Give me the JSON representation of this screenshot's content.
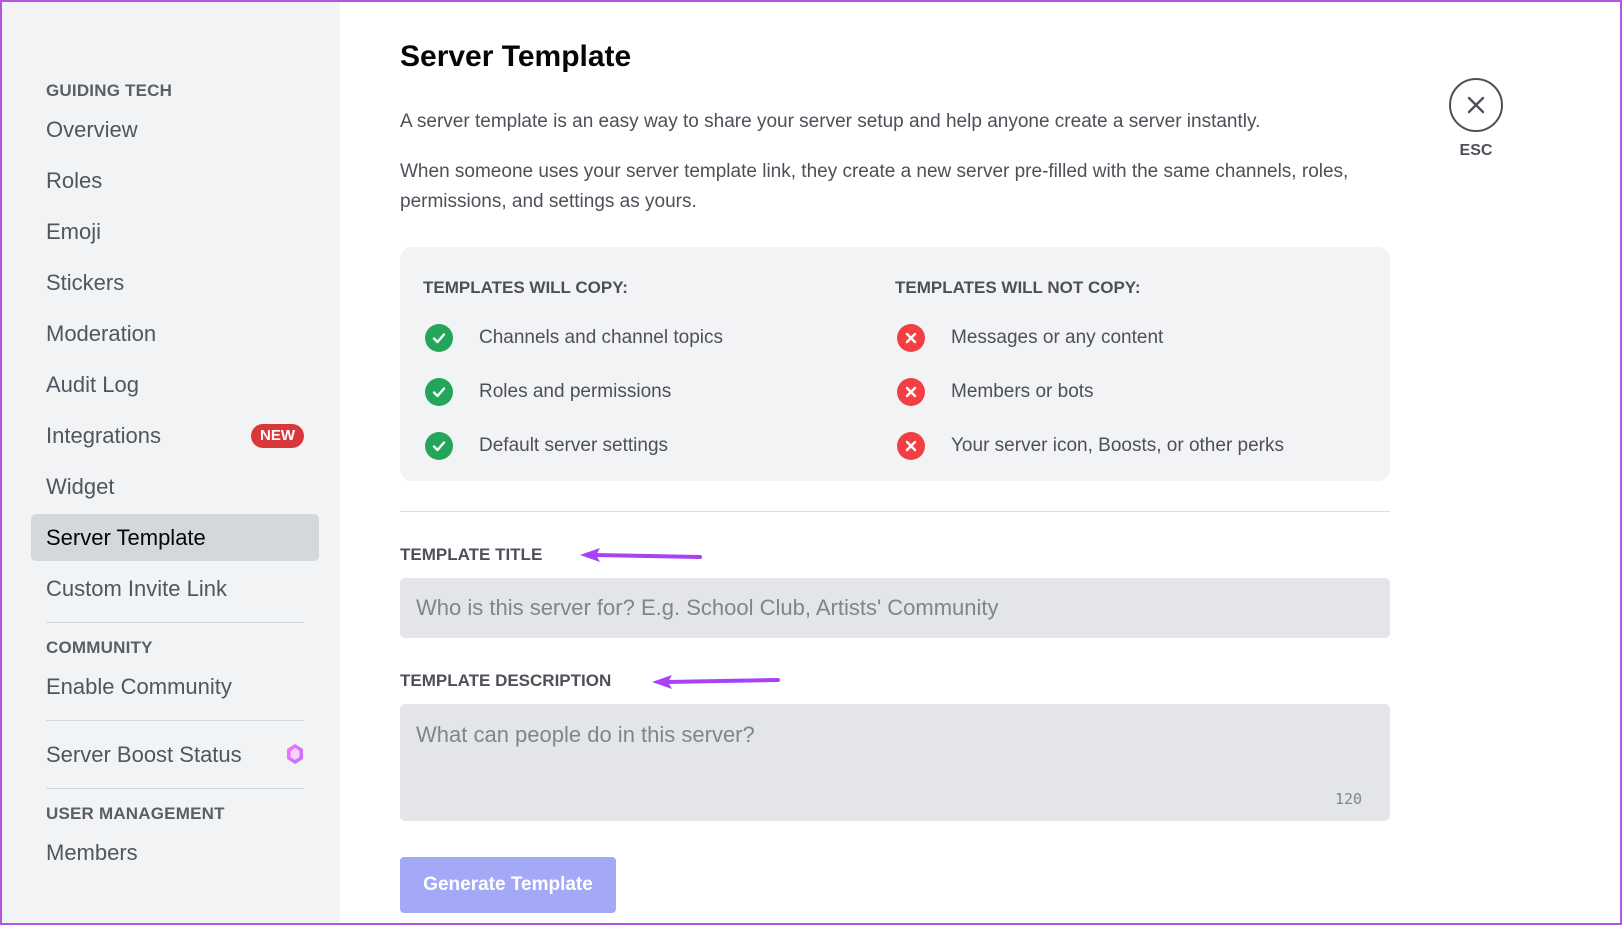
{
  "sidebar": {
    "sections": [
      {
        "header": "GUIDING TECH",
        "items": [
          {
            "label": "Overview"
          },
          {
            "label": "Roles"
          },
          {
            "label": "Emoji"
          },
          {
            "label": "Stickers"
          },
          {
            "label": "Moderation"
          },
          {
            "label": "Audit Log"
          },
          {
            "label": "Integrations",
            "badge": "NEW"
          },
          {
            "label": "Widget"
          },
          {
            "label": "Server Template",
            "active": true
          },
          {
            "label": "Custom Invite Link"
          }
        ]
      },
      {
        "header": "COMMUNITY",
        "items": [
          {
            "label": "Enable Community"
          }
        ]
      },
      {
        "header": "",
        "items": [
          {
            "label": "Server Boost Status",
            "icon": "boost-gem-icon"
          }
        ]
      },
      {
        "header": "USER MANAGEMENT",
        "items": [
          {
            "label": "Members"
          }
        ]
      }
    ]
  },
  "main": {
    "title": "Server Template",
    "description_1": "A server template is an easy way to share your server setup and help anyone create a server instantly.",
    "description_2": "When someone uses your server template link, they create a new server pre-filled with the same channels, roles, permissions, and settings as yours.",
    "will_copy": {
      "header": "TEMPLATES WILL COPY:",
      "items": [
        "Channels and channel topics",
        "Roles and permissions",
        "Default server settings"
      ]
    },
    "will_not_copy": {
      "header": "TEMPLATES WILL NOT COPY:",
      "items": [
        "Messages or any content",
        "Members or bots",
        "Your server icon, Boosts, or other perks"
      ]
    },
    "template_title": {
      "label": "TEMPLATE TITLE",
      "placeholder": "Who is this server for? E.g. School Club, Artists' Community",
      "value": ""
    },
    "template_description": {
      "label": "TEMPLATE DESCRIPTION",
      "placeholder": "What can people do in this server?",
      "value": "",
      "char_remaining": "120"
    },
    "generate_button": "Generate Template",
    "close_label": "ESC"
  },
  "colors": {
    "accent": "#a3a9f7",
    "check": "#23a55a",
    "cross": "#f23f43",
    "badge": "#da373c",
    "annotation_arrow": "#a742f5"
  }
}
